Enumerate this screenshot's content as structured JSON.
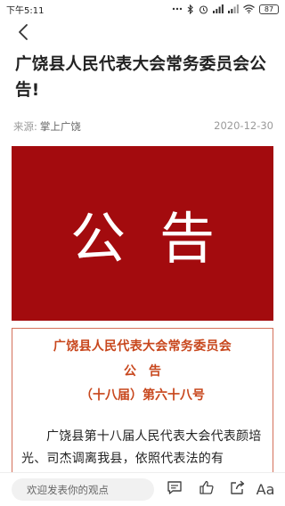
{
  "status_bar": {
    "time": "下午5:11",
    "battery": "87"
  },
  "article": {
    "title": "广饶县人民代表大会常务委员会公告!",
    "source_label": "来源:",
    "source_name": "掌上广饶",
    "date": "2020-12-30"
  },
  "banner": {
    "text": "公告"
  },
  "notice": {
    "org": "广饶县人民代表大会常务委员会",
    "heading": "公告",
    "number": "（十八届）第六十八号",
    "body": "广饶县第十八届人民代表大会代表颜培光、司杰调离我县，依照代表法的有"
  },
  "bottom_bar": {
    "comment_placeholder": "欢迎发表你的观点",
    "font_label": "Aa"
  }
}
